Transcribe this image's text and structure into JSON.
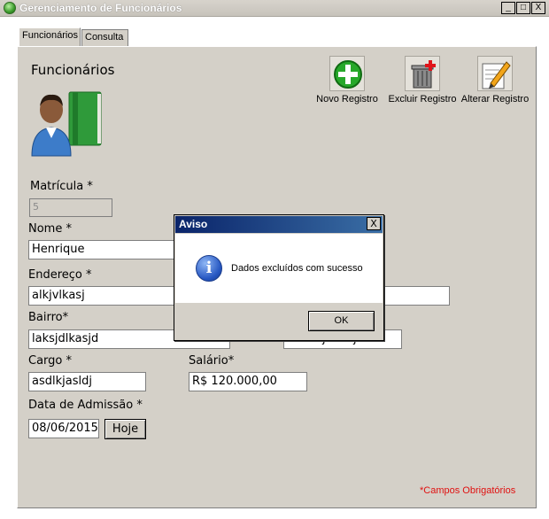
{
  "window": {
    "title": "Gerenciamento de Funcionários",
    "minimize": "_",
    "maximize": "□",
    "close": "X"
  },
  "tabs": [
    {
      "label": "Funcionários",
      "active": true
    },
    {
      "label": "Consulta",
      "active": false
    }
  ],
  "heading": "Funcionários",
  "toolbar": {
    "new_label": "Novo Registro",
    "delete_label": "Excluir Registro",
    "edit_label": "Alterar Registro"
  },
  "form": {
    "matricula": {
      "label": "Matrícula *",
      "value": "5"
    },
    "nome": {
      "label": "Nome *",
      "value": "Henrique"
    },
    "endereco": {
      "label": "Endereço *",
      "value": "alkjvlkasj"
    },
    "bairro": {
      "label": "Bairro*",
      "value": "laksjdlkasjd"
    },
    "hidden_field_value": "dsfdkfjdslfdj",
    "cargo": {
      "label": "Cargo *",
      "value": "asdlkjasldj"
    },
    "salario": {
      "label": "Salário*",
      "value": "R$ 120.000,00"
    },
    "data_admissao": {
      "label": "Data de Admissão *",
      "value": "08/06/2015"
    },
    "hoje_label": "Hoje"
  },
  "required_note": "*Campos Obrigatórios",
  "dialog": {
    "title": "Aviso",
    "close": "X",
    "icon": "info-icon",
    "icon_glyph": "i",
    "message": "Dados excluídos com sucesso",
    "ok_label": "OK"
  },
  "colors": {
    "dialog_title_bg": "#0a246a",
    "required_note": "#e01010",
    "panel_bg": "#d4d0c8"
  }
}
